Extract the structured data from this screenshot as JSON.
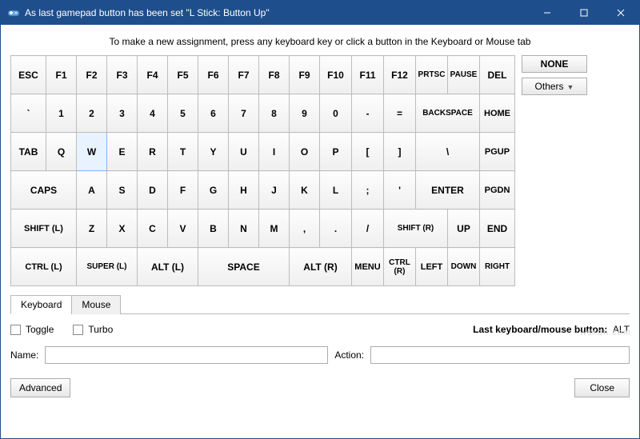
{
  "title": "As last gamepad button has been set \"L Stick: Button Up\"",
  "instruction": "To make a new assignment, press any keyboard key or click a button in the Keyboard or Mouse tab",
  "side": {
    "none": "NONE",
    "others": "Others"
  },
  "keys": {
    "r0": [
      "ESC",
      "F1",
      "F2",
      "F3",
      "F4",
      "F5",
      "F6",
      "F7",
      "F8",
      "F9",
      "F10",
      "F11",
      "F12",
      "PRTSC",
      "PAUSE",
      "DEL"
    ],
    "r1": [
      "`",
      "1",
      "2",
      "3",
      "4",
      "5",
      "6",
      "7",
      "8",
      "9",
      "0",
      "-",
      "=",
      "BACKSPACE",
      "HOME"
    ],
    "r2": [
      "TAB",
      "Q",
      "W",
      "E",
      "R",
      "T",
      "Y",
      "U",
      "I",
      "O",
      "P",
      "[",
      "]",
      "\\",
      "PGUP"
    ],
    "r3": [
      "CAPS",
      "A",
      "S",
      "D",
      "F",
      "G",
      "H",
      "J",
      "K",
      "L",
      ";",
      "'",
      "ENTER",
      "PGDN"
    ],
    "r4": [
      "SHIFT (L)",
      "Z",
      "X",
      "C",
      "V",
      "B",
      "N",
      "M",
      ",",
      ".",
      "/",
      "SHIFT (R)",
      "UP",
      "END"
    ],
    "r5": [
      "CTRL (L)",
      "SUPER (L)",
      "ALT (L)",
      "SPACE",
      "ALT (R)",
      "MENU",
      "CTRL (R)",
      "LEFT",
      "DOWN",
      "RIGHT"
    ]
  },
  "tabs": {
    "keyboard": "Keyboard",
    "mouse": "Mouse"
  },
  "check": {
    "toggle": "Toggle",
    "turbo": "Turbo"
  },
  "last": {
    "label": "Last keyboard/mouse button:",
    "value": "ALT"
  },
  "labels": {
    "name": "Name:",
    "action": "Action:"
  },
  "buttons": {
    "advanced": "Advanced",
    "close": "Close"
  },
  "watermark": "wsxdn.com"
}
